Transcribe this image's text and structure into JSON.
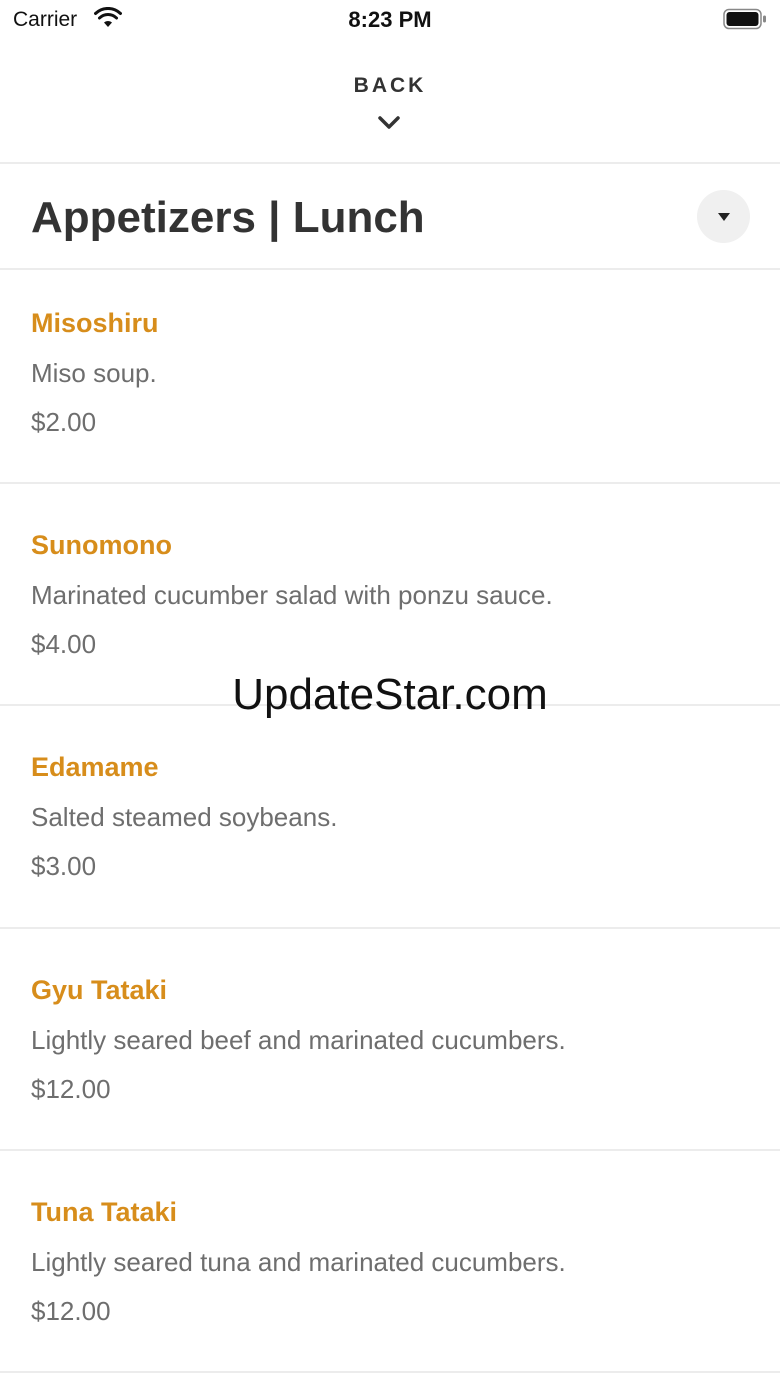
{
  "status_bar": {
    "carrier": "Carrier",
    "time": "8:23 PM"
  },
  "nav": {
    "back_label": "BACK"
  },
  "header": {
    "title": "Appetizers | Lunch"
  },
  "menu_items": [
    {
      "name": "Misoshiru",
      "description": "Miso soup.",
      "price": "$2.00"
    },
    {
      "name": "Sunomono",
      "description": "Marinated cucumber salad with ponzu sauce.",
      "price": "$4.00"
    },
    {
      "name": "Edamame",
      "description": "Salted steamed soybeans.",
      "price": "$3.00"
    },
    {
      "name": "Gyu Tataki",
      "description": "Lightly seared beef and marinated cucumbers.",
      "price": "$12.00"
    },
    {
      "name": "Tuna Tataki",
      "description": "Lightly seared tuna and marinated cucumbers.",
      "price": "$12.00"
    }
  ],
  "watermark": "UpdateStar.com",
  "colors": {
    "accent": "#d78d1b",
    "text_dark": "#333333",
    "text_muted": "#6e6e6e",
    "divider": "#ececec"
  }
}
